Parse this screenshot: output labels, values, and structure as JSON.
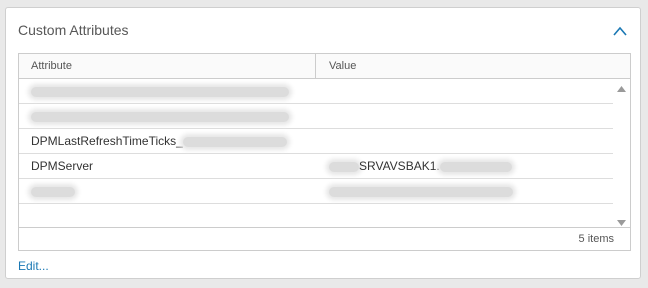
{
  "card": {
    "title": "Custom Attributes",
    "collapse_icon": "chevron-up-icon",
    "accent_color": "#1a78b4"
  },
  "grid": {
    "columns": [
      "Attribute",
      "Value"
    ],
    "rows": [
      {
        "attribute": "",
        "value": ""
      },
      {
        "attribute": "",
        "value": ""
      },
      {
        "attribute": "DPMLastRefreshTimeTicks_",
        "value": ""
      },
      {
        "attribute": "DPMServer",
        "value": "SRVAVSBAK1."
      },
      {
        "attribute": "",
        "value": ""
      }
    ],
    "footer": "5 items"
  },
  "edit_link": "Edit..."
}
